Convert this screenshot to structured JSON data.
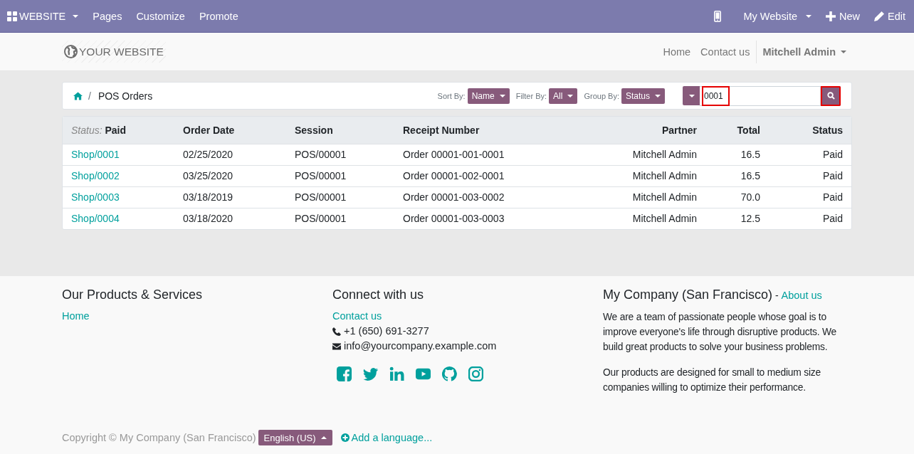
{
  "topbar": {
    "apps": "WEBSITE",
    "menu": [
      "Pages",
      "Customize",
      "Promote"
    ],
    "website": "My Website",
    "new": "New",
    "edit": "Edit"
  },
  "header": {
    "logo": "YOUR WEBSITE",
    "nav": [
      "Home",
      "Contact us"
    ],
    "user": "Mitchell Admin"
  },
  "breadcrumb": {
    "separator": "/",
    "current": "POS Orders"
  },
  "controls": [
    {
      "label": "Sort By:",
      "value": "Name"
    },
    {
      "label": "Filter By:",
      "value": "All"
    },
    {
      "label": "Group By:",
      "value": "Status"
    }
  ],
  "search": {
    "value": "0001",
    "highlighted": true,
    "button_highlighted": true
  },
  "table": {
    "columns": [
      {
        "prefix": "Status:",
        "label": "Paid"
      },
      {
        "label": "Order Date"
      },
      {
        "label": "Session"
      },
      {
        "label": "Receipt Number"
      },
      {
        "label": "Partner"
      },
      {
        "label": "Total"
      },
      {
        "label": "Status"
      }
    ],
    "rows": [
      [
        "Shop/0001",
        "02/25/2020",
        "POS/00001",
        "Order 00001-001-0001",
        "Mitchell Admin",
        "16.5",
        "Paid"
      ],
      [
        "Shop/0002",
        "03/25/2020",
        "POS/00001",
        "Order 00001-002-0001",
        "Mitchell Admin",
        "16.5",
        "Paid"
      ],
      [
        "Shop/0003",
        "03/18/2019",
        "POS/00001",
        "Order 00001-003-0002",
        "Mitchell Admin",
        "70.0",
        "Paid"
      ],
      [
        "Shop/0004",
        "03/18/2020",
        "POS/00001",
        "Order 00001-003-0003",
        "Mitchell Admin",
        "12.5",
        "Paid"
      ]
    ]
  },
  "footer": {
    "col1": {
      "title": "Our Products & Services",
      "links": [
        "Home"
      ]
    },
    "col2": {
      "title": "Connect with us",
      "link": "Contact us",
      "phone": "+1 (650) 691-3277",
      "email": "info@yourcompany.example.com"
    },
    "col3": {
      "title": "My Company (San Francisco)",
      "sep": " - ",
      "link": "About us",
      "paragraphs": [
        "We are a team of passionate people whose goal is to improve everyone's life through disruptive products. We build great products to solve your business problems.",
        "Our products are designed for small to medium size companies willing to optimize their performance."
      ]
    },
    "copyright": "Copyright © My Company (San Francisco)",
    "language": "English (US)",
    "add_language": "Add a language..."
  }
}
